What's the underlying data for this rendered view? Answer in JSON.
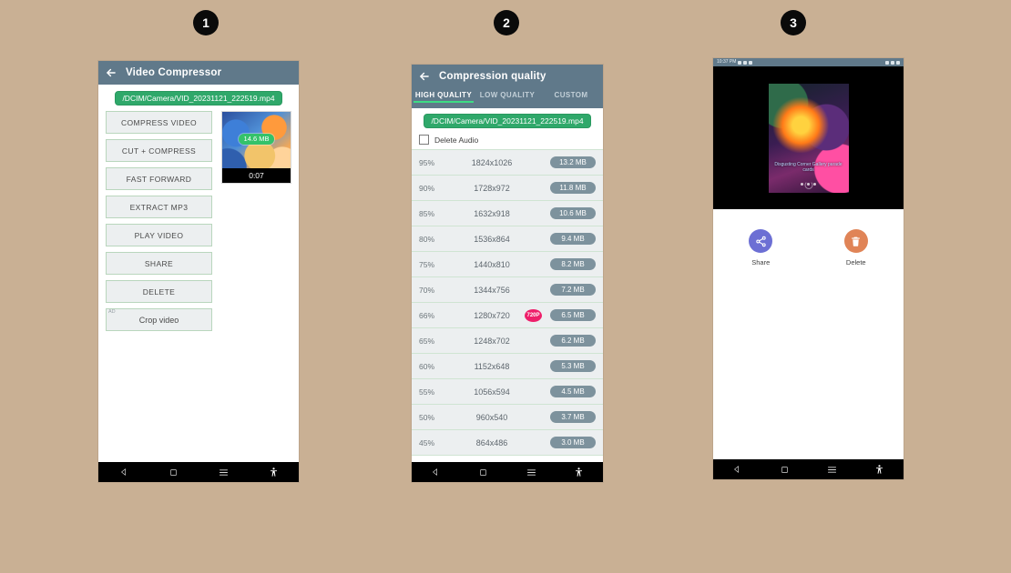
{
  "background_color": "#c9b094",
  "steps": [
    {
      "number": "1"
    },
    {
      "number": "2"
    },
    {
      "number": "3"
    }
  ],
  "panel1": {
    "appbar": {
      "title": "Video Compressor",
      "back_icon": "arrow-left-icon"
    },
    "filename_chip": "/DCIM/Camera/VID_20231121_222519.mp4",
    "buttons": [
      {
        "label": "COMPRESS VIDEO",
        "ad": false
      },
      {
        "label": "CUT + COMPRESS",
        "ad": false
      },
      {
        "label": "FAST FORWARD",
        "ad": false
      },
      {
        "label": "EXTRACT MP3",
        "ad": false
      },
      {
        "label": "PLAY VIDEO",
        "ad": false
      },
      {
        "label": "SHARE",
        "ad": false
      },
      {
        "label": "DELETE",
        "ad": false
      },
      {
        "label": "Crop video",
        "ad": true,
        "ad_tag": "AD"
      }
    ],
    "thumbnail": {
      "size_badge": "14.6 MB",
      "duration": "0:07"
    }
  },
  "panel2": {
    "appbar": {
      "title": "Compression quality",
      "back_icon": "arrow-left-icon"
    },
    "tabs": [
      {
        "label": "HIGH QUALITY",
        "active": true
      },
      {
        "label": "LOW QUALITY",
        "active": false
      },
      {
        "label": "CUSTOM",
        "active": false
      }
    ],
    "filename_chip": "/DCIM/Camera/VID_20231121_222519.mp4",
    "delete_audio": {
      "label": "Delete Audio",
      "checked": false
    },
    "quality_rows": [
      {
        "percent": "95%",
        "resolution": "1824x1026",
        "size": "13.2 MB",
        "badge": ""
      },
      {
        "percent": "90%",
        "resolution": "1728x972",
        "size": "11.8 MB",
        "badge": ""
      },
      {
        "percent": "85%",
        "resolution": "1632x918",
        "size": "10.6 MB",
        "badge": ""
      },
      {
        "percent": "80%",
        "resolution": "1536x864",
        "size": "9.4 MB",
        "badge": ""
      },
      {
        "percent": "75%",
        "resolution": "1440x810",
        "size": "8.2 MB",
        "badge": ""
      },
      {
        "percent": "70%",
        "resolution": "1344x756",
        "size": "7.2 MB",
        "badge": ""
      },
      {
        "percent": "66%",
        "resolution": "1280x720",
        "size": "6.5 MB",
        "badge": "720P"
      },
      {
        "percent": "65%",
        "resolution": "1248x702",
        "size": "6.2 MB",
        "badge": ""
      },
      {
        "percent": "60%",
        "resolution": "1152x648",
        "size": "5.3 MB",
        "badge": ""
      },
      {
        "percent": "55%",
        "resolution": "1056x594",
        "size": "4.5 MB",
        "badge": ""
      },
      {
        "percent": "50%",
        "resolution": "960x540",
        "size": "3.7 MB",
        "badge": ""
      },
      {
        "percent": "45%",
        "resolution": "864x486",
        "size": "3.0 MB",
        "badge": ""
      }
    ]
  },
  "panel3": {
    "statusbar": {
      "time": "10:37 PM"
    },
    "poster_caption": "Disgusting Corner Gallery parade cards",
    "actions": [
      {
        "label": "Share",
        "icon": "share-icon",
        "color": "#6c6fd4"
      },
      {
        "label": "Delete",
        "icon": "trash-icon",
        "color": "#e08457"
      }
    ]
  },
  "navbar": {
    "back_icon": "triangle-back-icon",
    "home_icon": "square-home-icon",
    "recents_icon": "hamburger-recents-icon",
    "accessibility_icon": "accessibility-icon"
  },
  "colors": {
    "appbar": "#60798a",
    "chip_green": "#2fa86a",
    "tab_indicator": "#3ddc84",
    "size_pill": "#7d929d",
    "badge_720p": "#ee1f6a",
    "button_face": "#eceff0",
    "button_border": "#b9d6bd"
  }
}
